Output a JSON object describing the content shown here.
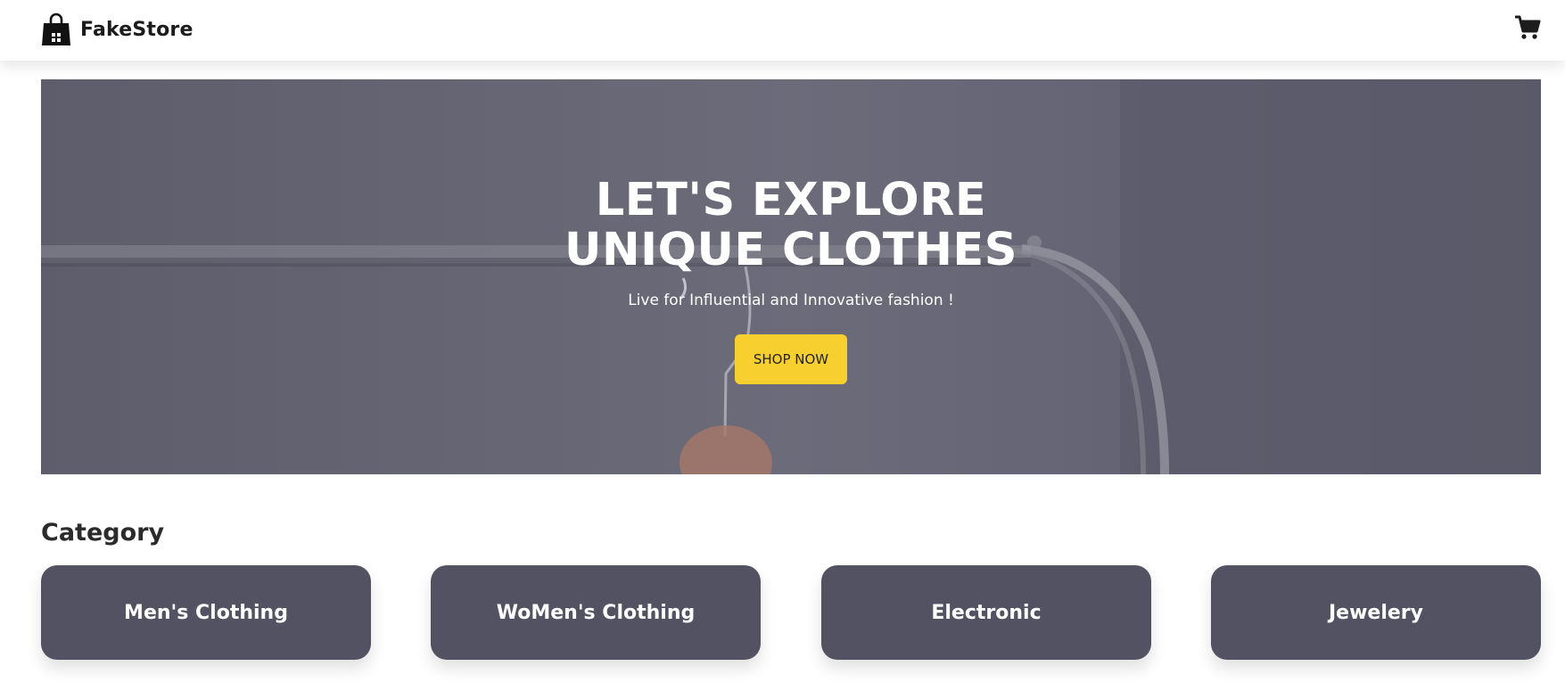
{
  "header": {
    "brand_name": "FakeStore",
    "brand_icon": "shopping-bag-icon",
    "cart_icon": "shopping-cart-icon"
  },
  "hero": {
    "title_line1": "LET'S EXPLORE",
    "title_line2": "UNIQUE CLOTHES",
    "subtitle": "Live for Influential and Innovative fashion !",
    "button_label": "SHOP NOW",
    "button_color": "#f7d02f",
    "overlay_color": "#666675"
  },
  "category": {
    "heading": "Category",
    "card_color": "#535263",
    "items": [
      {
        "label": "Men's Clothing"
      },
      {
        "label": "WoMen's Clothing"
      },
      {
        "label": "Electronic"
      },
      {
        "label": "Jewelery"
      }
    ]
  }
}
